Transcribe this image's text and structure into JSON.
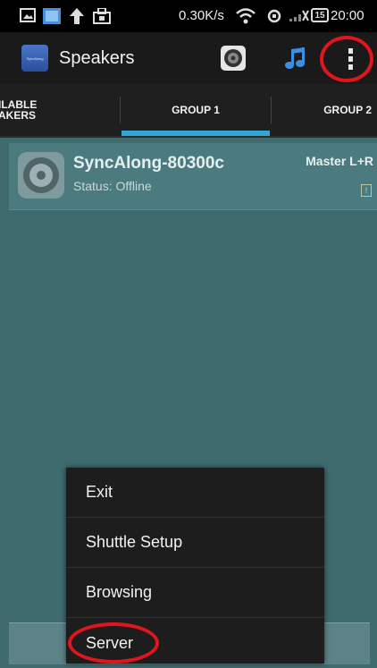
{
  "status_bar": {
    "speed": "0.30K/s",
    "battery": "15",
    "time": "20:00"
  },
  "action_bar": {
    "app_icon_text": "SyncAlong",
    "title": "Speakers"
  },
  "tabs": [
    {
      "label_line1": "ILABLE",
      "label_line2": "AKERS"
    },
    {
      "label": "GROUP 1"
    },
    {
      "label": "GROUP 2"
    }
  ],
  "speaker": {
    "name": "SyncAlong-80300c",
    "status": "Status: Offline",
    "role": "Master  L+R",
    "flag": "!"
  },
  "menu": {
    "items": [
      "Exit",
      "Shuttle Setup",
      "Browsing",
      "Server"
    ]
  },
  "colors": {
    "background": "#3f6b6f",
    "tab_indicator": "#33a5d8",
    "highlight_ring": "#e0151d"
  }
}
